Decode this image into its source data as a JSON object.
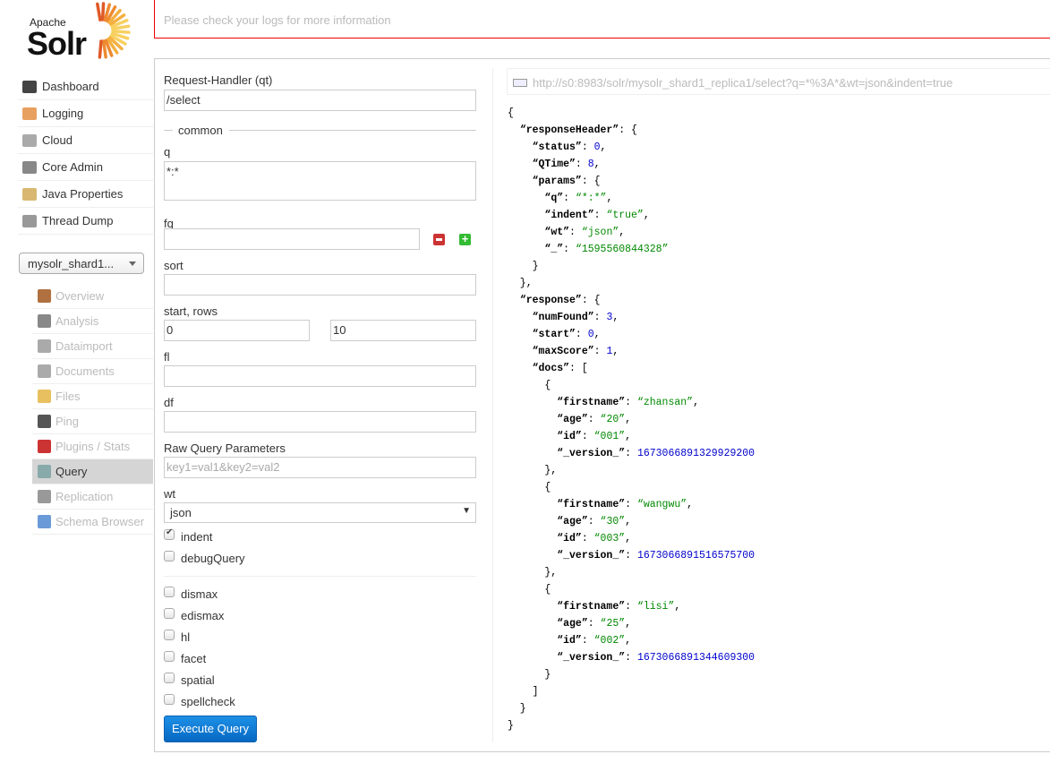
{
  "logo": {
    "apache": "Apache",
    "solr": "Solr"
  },
  "error": {
    "message": "Please check your logs for more information"
  },
  "nav": {
    "items": [
      {
        "label": "Dashboard",
        "icon": "dashboard-icon",
        "color": "#444"
      },
      {
        "label": "Logging",
        "icon": "logging-icon",
        "color": "#e8a060"
      },
      {
        "label": "Cloud",
        "icon": "cloud-icon",
        "color": "#aaa"
      },
      {
        "label": "Core Admin",
        "icon": "core-admin-icon",
        "color": "#888"
      },
      {
        "label": "Java Properties",
        "icon": "java-properties-icon",
        "color": "#d8b870"
      },
      {
        "label": "Thread Dump",
        "icon": "thread-dump-icon",
        "color": "#999"
      }
    ]
  },
  "core_selector": {
    "value": "mysolr_shard1..."
  },
  "core_nav": {
    "items": [
      {
        "label": "Overview",
        "icon": "home-icon",
        "color": "#b07040"
      },
      {
        "label": "Analysis",
        "icon": "funnel-icon",
        "color": "#888"
      },
      {
        "label": "Dataimport",
        "icon": "dataimport-icon",
        "color": "#aaa"
      },
      {
        "label": "Documents",
        "icon": "documents-icon",
        "color": "#aaa"
      },
      {
        "label": "Files",
        "icon": "files-icon",
        "color": "#e8c060"
      },
      {
        "label": "Ping",
        "icon": "ping-icon",
        "color": "#555"
      },
      {
        "label": "Plugins / Stats",
        "icon": "plugins-icon",
        "color": "#c33"
      },
      {
        "label": "Query",
        "icon": "search-icon",
        "color": "#8aa"
      },
      {
        "label": "Replication",
        "icon": "replication-icon",
        "color": "#999"
      },
      {
        "label": "Schema Browser",
        "icon": "schema-browser-icon",
        "color": "#6a9bd8"
      }
    ],
    "active": "Query"
  },
  "form": {
    "qt_label": "Request-Handler (qt)",
    "qt_value": "/select",
    "common_legend": "common",
    "q_label": "q",
    "q_value": "*:*",
    "fq_label": "fq",
    "fq_value": "",
    "sort_label": "sort",
    "sort_value": "",
    "start_rows_label": "start, rows",
    "start_value": "0",
    "rows_value": "10",
    "fl_label": "fl",
    "fl_value": "",
    "df_label": "df",
    "df_value": "",
    "raw_label": "Raw Query Parameters",
    "raw_placeholder": "key1=val1&key2=val2",
    "wt_label": "wt",
    "wt_value": "json",
    "checkboxes": [
      {
        "label": "indent",
        "checked": true
      },
      {
        "label": "debugQuery",
        "checked": false
      }
    ],
    "options": [
      {
        "label": "dismax",
        "checked": false
      },
      {
        "label": "edismax",
        "checked": false
      },
      {
        "label": "hl",
        "checked": false
      },
      {
        "label": "facet",
        "checked": false
      },
      {
        "label": "spatial",
        "checked": false
      },
      {
        "label": "spellcheck",
        "checked": false
      }
    ],
    "execute_label": "Execute Query"
  },
  "result": {
    "url": "http://s0:8983/solr/mysolr_shard1_replica1/select?q=*%3A*&wt=json&indent=true",
    "response": {
      "responseHeader": {
        "status": 0,
        "QTime": 8,
        "params": {
          "q": "*:*",
          "indent": "true",
          "wt": "json",
          "_": "1595560844328"
        }
      },
      "response": {
        "numFound": 3,
        "start": 0,
        "maxScore": 1,
        "docs": [
          {
            "firstname": "zhansan",
            "age": "20",
            "id": "001",
            "_version_": 1673066891329929200
          },
          {
            "firstname": "wangwu",
            "age": "30",
            "id": "003",
            "_version_": 1673066891516575700
          },
          {
            "firstname": "lisi",
            "age": "25",
            "id": "002",
            "_version_": 1673066891344609300
          }
        ]
      }
    }
  }
}
